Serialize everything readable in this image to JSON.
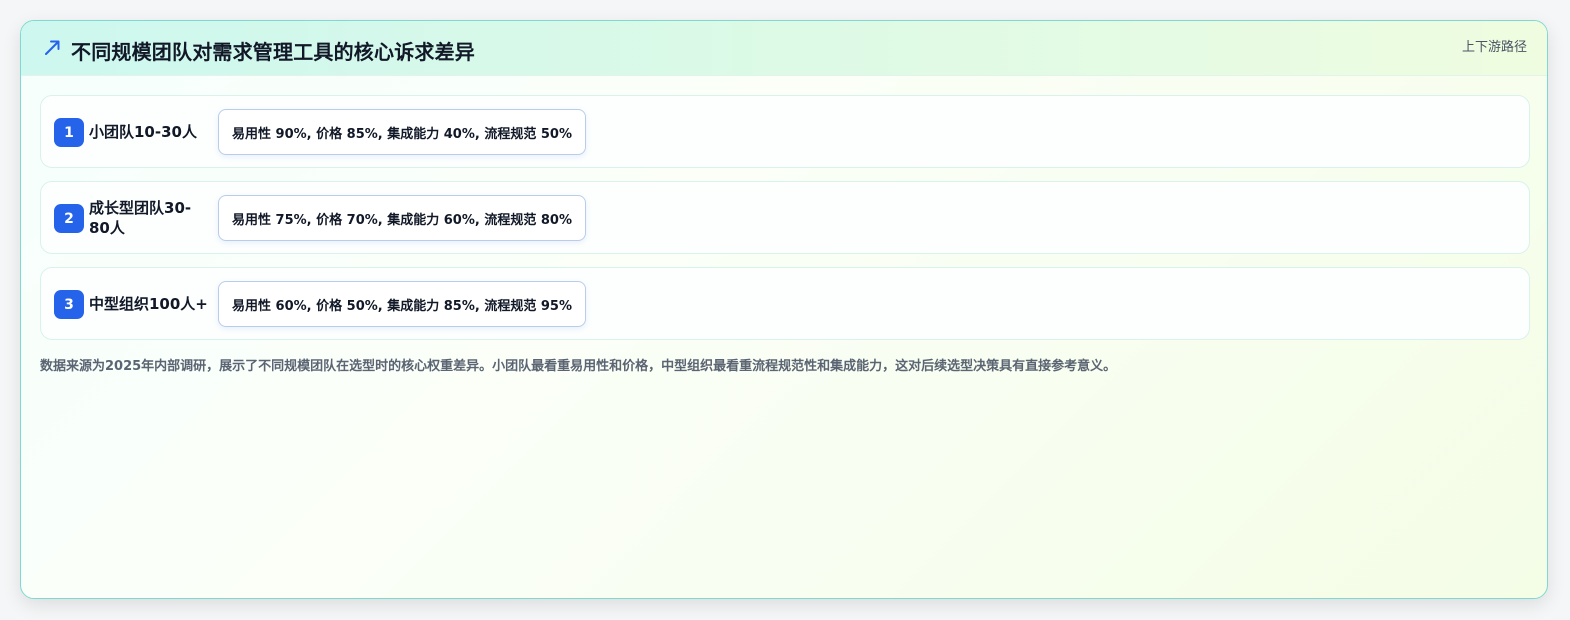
{
  "header": {
    "title": "不同规模团队对需求管理工具的核心诉求差异",
    "tag": "上下游路径",
    "icon": "trend-arrow-icon",
    "accent": "#2563eb"
  },
  "rows": [
    {
      "number": "1",
      "label": "小团队10-30人",
      "stats": "易用性 90%, 价格 85%, 集成能力 40%, 流程规范 50%"
    },
    {
      "number": "2",
      "label": "成长型团队30-80人",
      "stats": "易用性 75%, 价格 70%, 集成能力 60%, 流程规范 80%"
    },
    {
      "number": "3",
      "label": "中型组织100人+",
      "stats": "易用性 60%, 价格 50%, 集成能力 85%, 流程规范 95%"
    }
  ],
  "note": "数据来源为2025年内部调研，展示了不同规模团队在选型时的核心权重差异。小团队最看重易用性和价格，中型组织最看重流程规范性和集成能力，这对后续选型决策具有直接参考意义。"
}
